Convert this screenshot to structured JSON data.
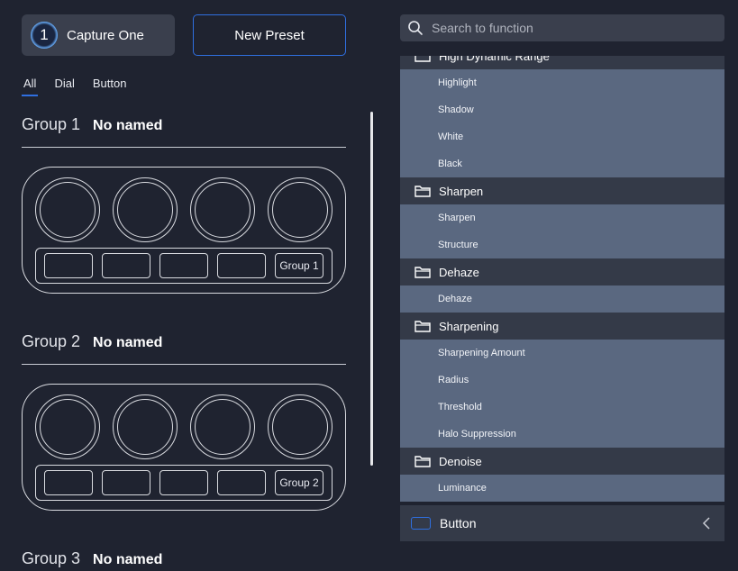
{
  "app": {
    "name": "Capture One",
    "logo_glyph": "1"
  },
  "header": {
    "new_preset_label": "New Preset"
  },
  "tabs": [
    {
      "label": "All",
      "active": true
    },
    {
      "label": "Dial",
      "active": false
    },
    {
      "label": "Button",
      "active": false
    }
  ],
  "groups": [
    {
      "number": "Group 1",
      "name": "No named",
      "last_button_label": "Group 1"
    },
    {
      "number": "Group 2",
      "name": "No named",
      "last_button_label": "Group 2"
    },
    {
      "number": "Group 3",
      "name": "No named"
    }
  ],
  "search": {
    "placeholder": "Search to function",
    "value": ""
  },
  "function_list": {
    "categories": [
      {
        "name": "High Dynamic Range",
        "items": [
          "Highlight",
          "Shadow",
          "White",
          "Black"
        ]
      },
      {
        "name": "Sharpen",
        "items": [
          "Sharpen",
          "Structure"
        ]
      },
      {
        "name": "Dehaze",
        "items": [
          "Dehaze"
        ]
      },
      {
        "name": "Sharpening",
        "items": [
          "Sharpening Amount",
          "Radius",
          "Threshold",
          "Halo Suppression"
        ]
      },
      {
        "name": "Denoise",
        "items": [
          "Luminance"
        ]
      }
    ]
  },
  "bottom_panel": {
    "label": "Button"
  },
  "colors": {
    "accent": "#2f6fe0",
    "background": "#1f2330",
    "category_bg": "#343a48",
    "item_bg": "#5a6880"
  }
}
